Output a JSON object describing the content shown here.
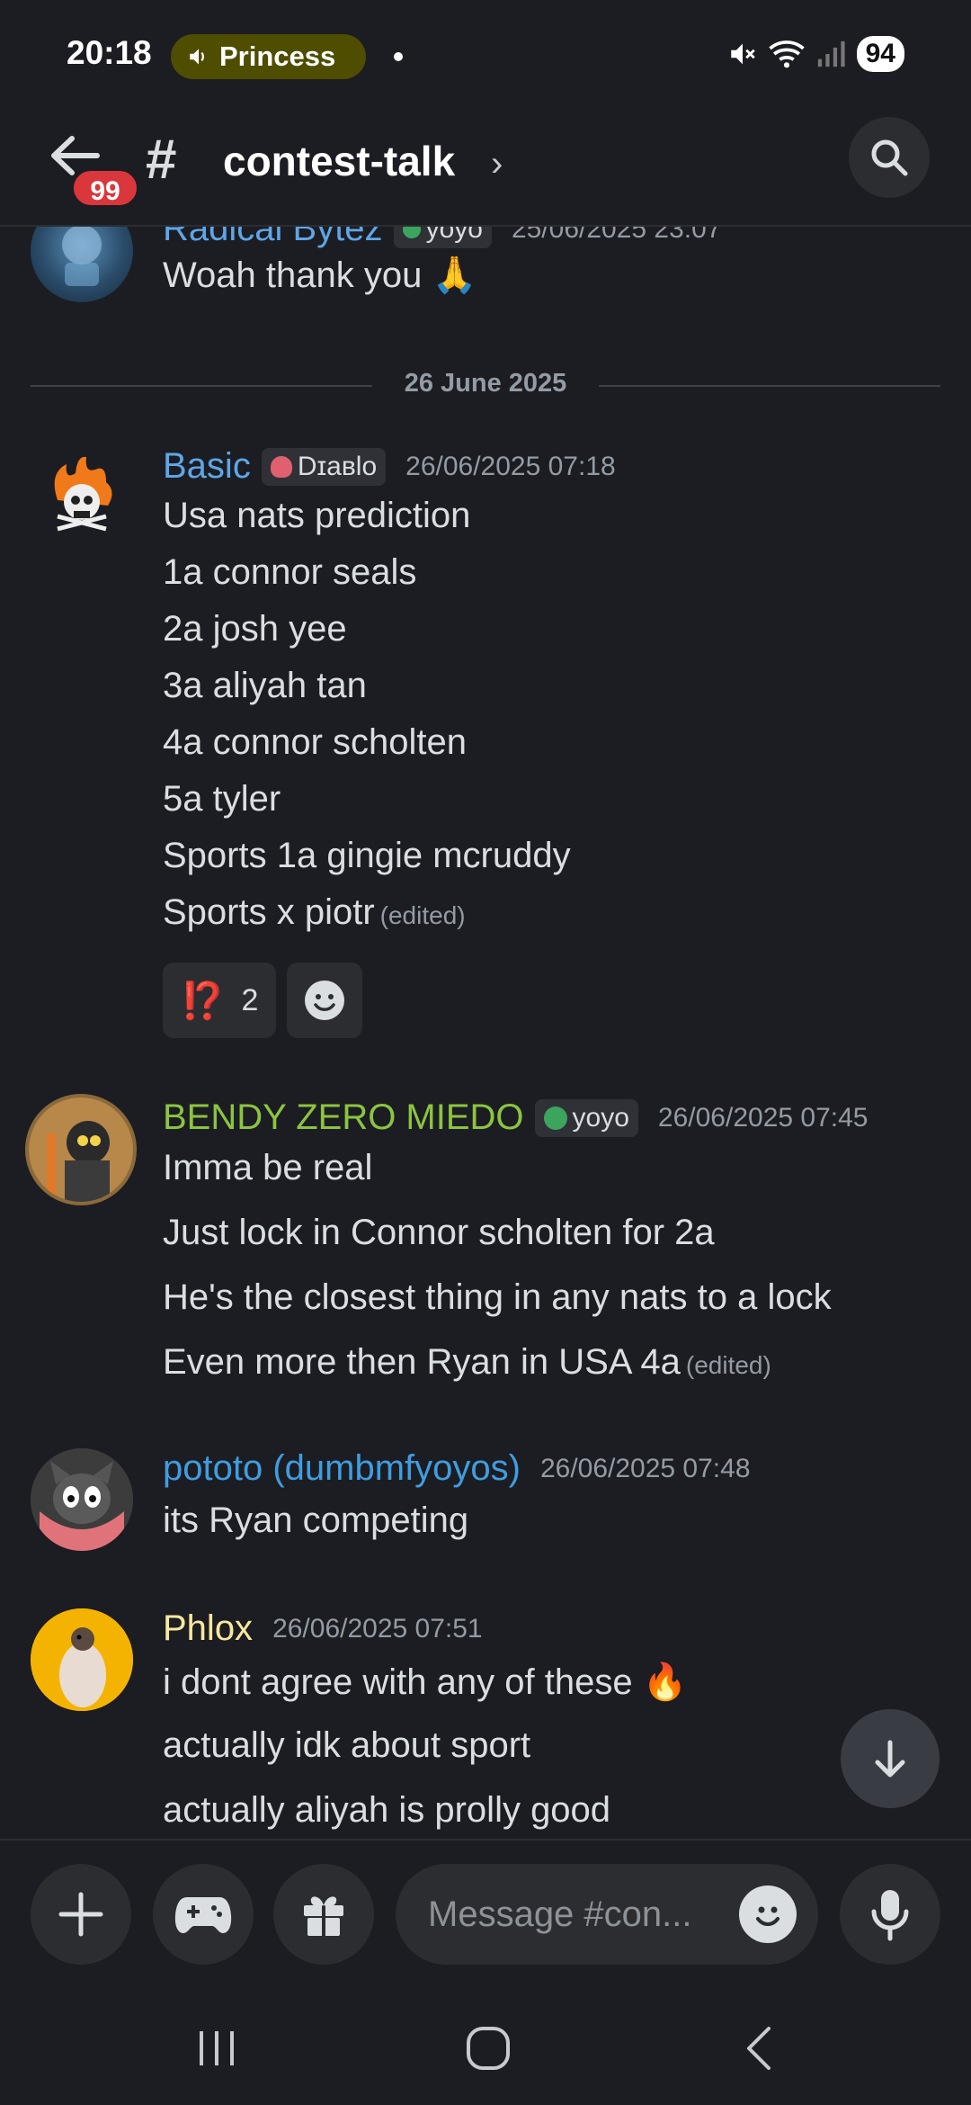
{
  "status_bar": {
    "time": "20:18",
    "pill_label": "Princess",
    "battery": "94"
  },
  "header": {
    "unread_badge": "99",
    "hash": "#",
    "channel_name": "contest-talk",
    "chevron": "›"
  },
  "messages": [
    {
      "username": "Radical Bytez",
      "name_color": "#5ea6e8",
      "tag": "yoyo",
      "timestamp": "25/06/2025 23:07",
      "lines": [
        "Woah thank you 🙏"
      ]
    },
    {
      "divider": "26 June 2025"
    },
    {
      "username": "Basic",
      "name_color": "#5ea6e8",
      "tag": "Dɪaʙlᴏ",
      "timestamp": "26/06/2025 07:18",
      "lines": [
        "Usa nats prediction",
        "1a connor seals",
        "2a josh yee",
        "3a aliyah tan",
        "4a connor scholten",
        "5a tyler",
        "Sports 1a gingie mcruddy",
        "Sports x piotr"
      ],
      "edited": "(edited)",
      "reaction": {
        "emoji": "⁉️",
        "count": "2"
      }
    },
    {
      "username": "BENDY ZERO MIEDO",
      "name_color": "#8bc53f",
      "tag": "yoyo",
      "timestamp": "26/06/2025 07:45",
      "lines": [
        "Imma be real",
        "Just lock in Connor scholten for 2a",
        "He's the closest thing in any nats to a lock",
        "Even more then Ryan in USA 4a"
      ],
      "edited": "(edited)"
    },
    {
      "username": "pototo (dumbmfyoyos)",
      "name_color": "#3f9de0",
      "timestamp": "26/06/2025 07:48",
      "lines": [
        "its Ryan competing"
      ]
    },
    {
      "username": "Phlox",
      "name_color": "#f9e79f",
      "timestamp": "26/06/2025 07:51",
      "lines": [
        "i dont agree with any of these 🔥",
        "actually idk about sport",
        "actually aliyah is prolly good"
      ]
    }
  ],
  "composer": {
    "placeholder": "Message #con..."
  },
  "colors": {
    "background": "#1c1d22",
    "surface": "#2b2d31",
    "badge": "#da373c"
  }
}
